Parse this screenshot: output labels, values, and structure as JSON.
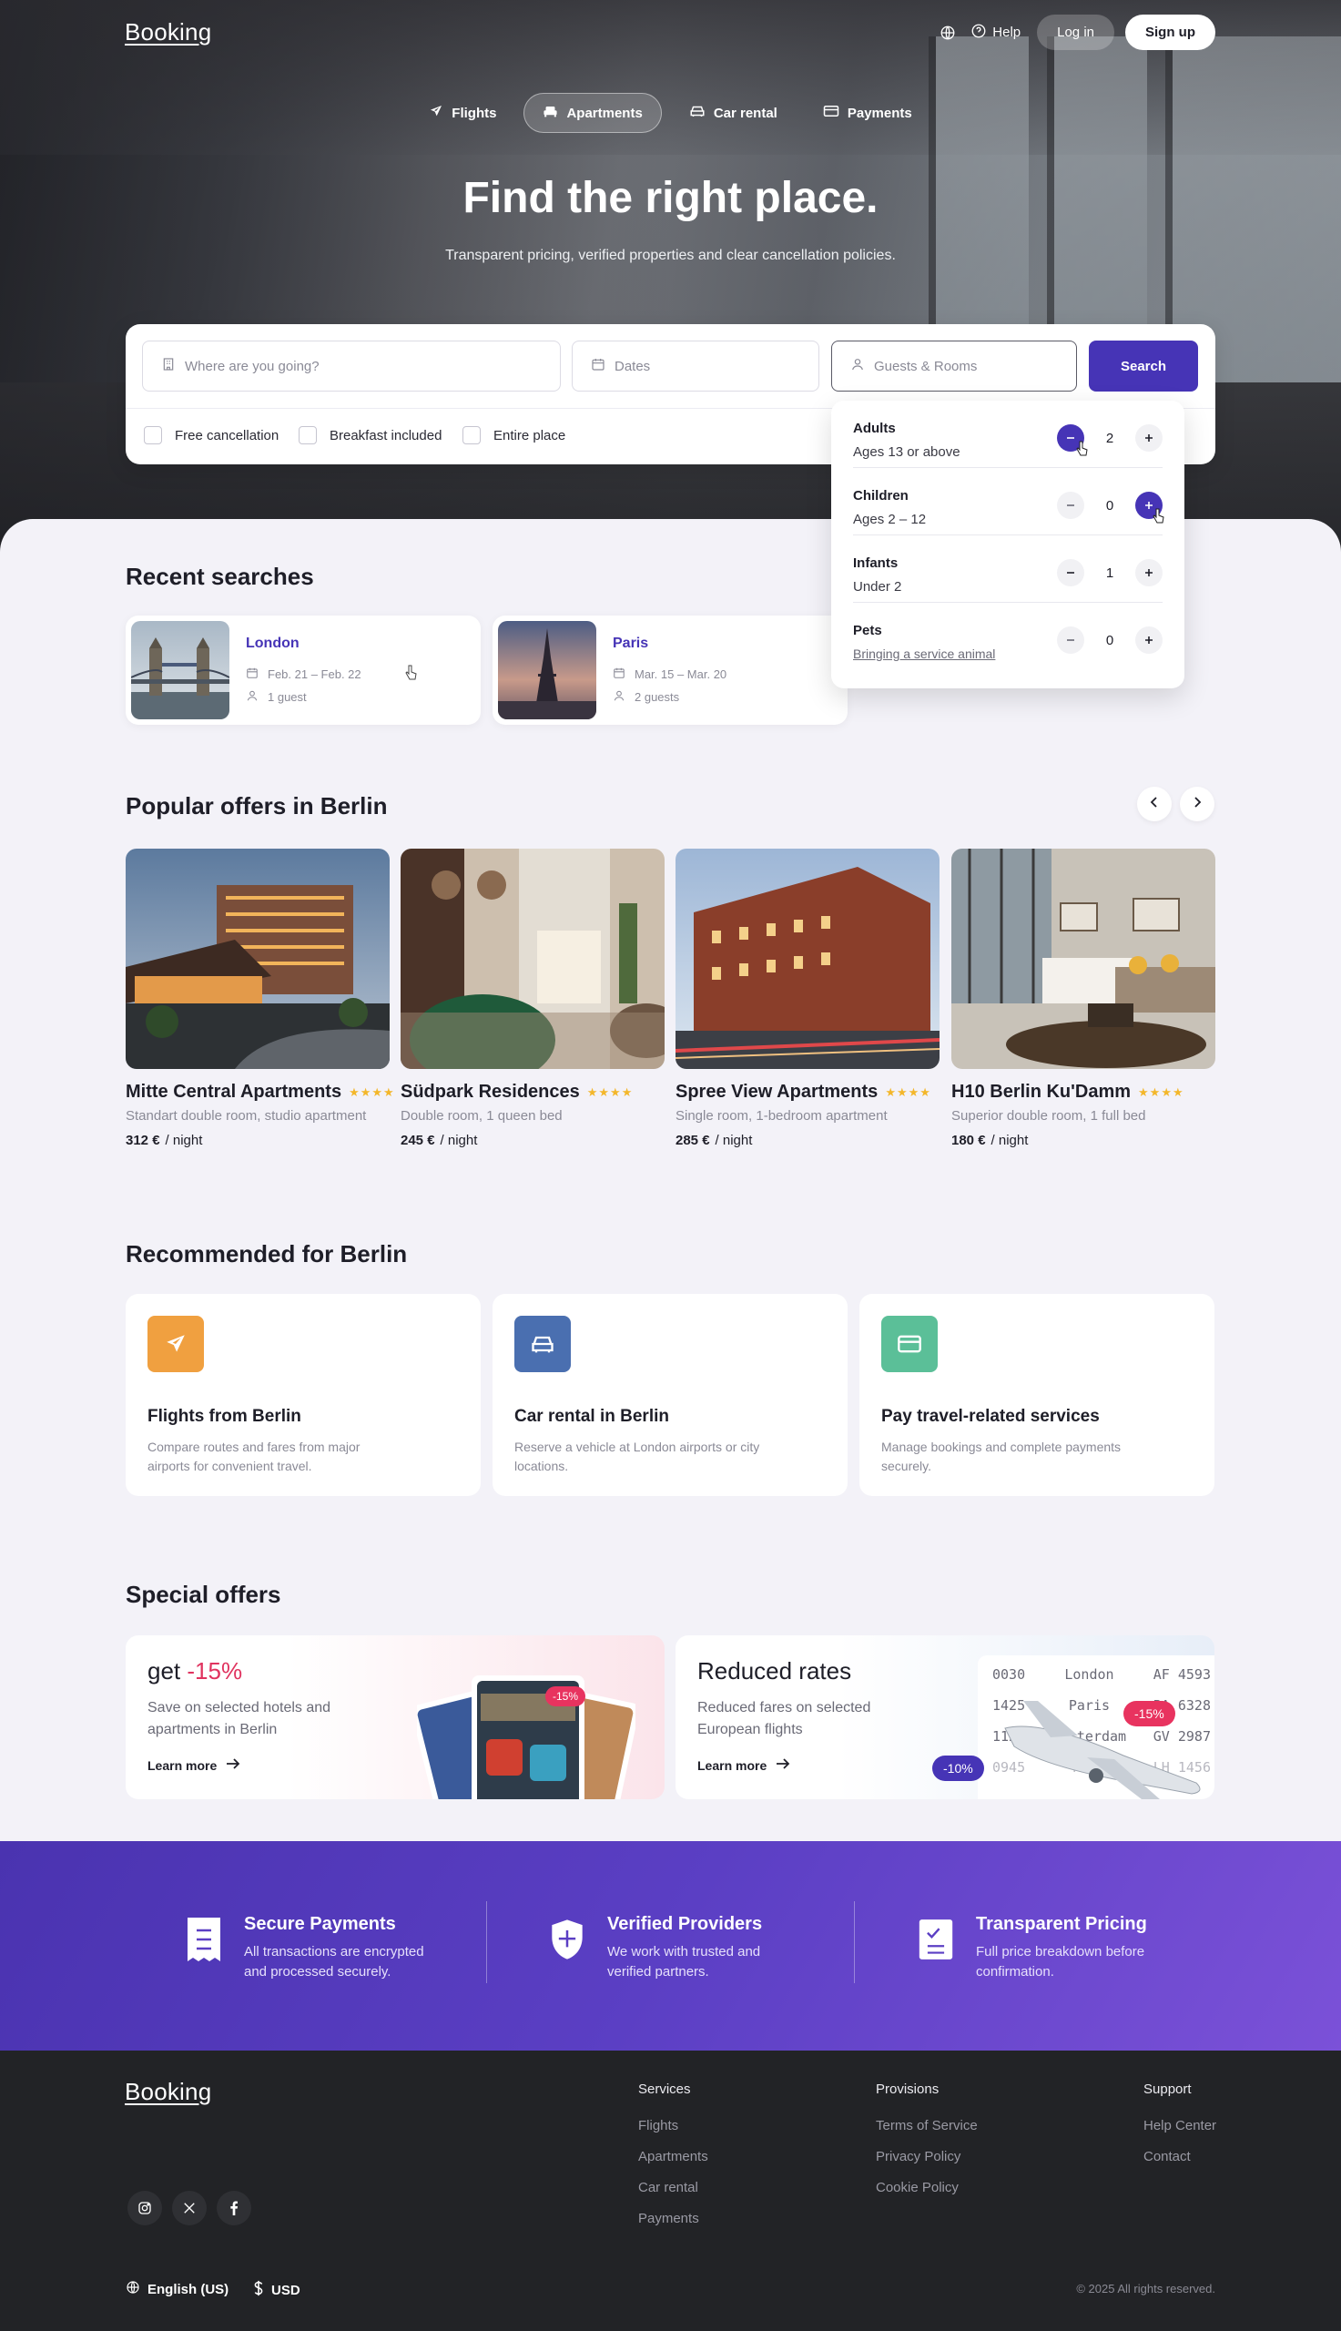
{
  "header": {
    "logo": "Booking",
    "help_label": "Help",
    "login_label": "Log in",
    "signup_label": "Sign up",
    "icons": [
      "globe-icon",
      "help-circle-icon"
    ]
  },
  "nav_tabs": [
    {
      "label": "Flights",
      "icon": "plane-icon",
      "active": false
    },
    {
      "label": "Apartments",
      "icon": "bed-icon",
      "active": true
    },
    {
      "label": "Car rental",
      "icon": "car-icon",
      "active": false
    },
    {
      "label": "Payments",
      "icon": "card-icon",
      "active": false
    }
  ],
  "hero": {
    "title": "Find the right place.",
    "subtitle": "Transparent pricing, verified properties and clear cancellation policies."
  },
  "search": {
    "destination_placeholder": "Where are you going?",
    "dates_placeholder": "Dates",
    "guests_placeholder": "Guests & Rooms",
    "button_label": "Search",
    "filters": [
      {
        "label": "Free cancellation",
        "checked": false
      },
      {
        "label": "Breakfast included",
        "checked": false
      },
      {
        "label": "Entire place",
        "checked": false
      }
    ]
  },
  "guests_dropdown": {
    "rows": [
      {
        "label": "Adults",
        "sub": "Ages 13 or above",
        "value": "2"
      },
      {
        "label": "Children",
        "sub": "Ages 2 – 12",
        "value": "0"
      },
      {
        "label": "Infants",
        "sub": "Under 2",
        "value": "1"
      },
      {
        "label": "Pets",
        "sub": "Bringing a service animal",
        "value": "0"
      }
    ]
  },
  "recent": {
    "title": "Recent searches",
    "items": [
      {
        "city": "London",
        "dates": "Feb. 21 – Feb. 22",
        "guests": "1 guest"
      },
      {
        "city": "Paris",
        "dates": "Mar. 15 – Mar. 20",
        "guests": "2 guests"
      }
    ]
  },
  "popular": {
    "title": "Popular offers in Berlin",
    "items": [
      {
        "name": "Mitte Central Apartments",
        "stars": "★★★★",
        "desc": "Standart double room, studio apartment",
        "price": "312 €",
        "unit": "/ night"
      },
      {
        "name": "Südpark Residences",
        "stars": "★★★★",
        "desc": "Double room, 1 queen bed",
        "price": "245 €",
        "unit": "/ night"
      },
      {
        "name": "Spree View Apartments",
        "stars": "★★★★",
        "desc": "Single room, 1-bedroom apartment",
        "price": "285 €",
        "unit": "/ night"
      },
      {
        "name": "H10 Berlin Ku'Damm",
        "stars": "★★★★",
        "desc": "Superior double room, 1 full bed",
        "price": "180 €",
        "unit": "/ night"
      }
    ]
  },
  "recommended": {
    "title": "Recommended for Berlin",
    "items": [
      {
        "title": "Flights from Berlin",
        "desc": "Compare routes and fares from major airports for convenient travel.",
        "color": "#f0a040"
      },
      {
        "title": "Car rental in Berlin",
        "desc": "Reserve a vehicle at London airports or city locations.",
        "color": "#4a6fb0"
      },
      {
        "title": "Pay travel-related services",
        "desc": "Manage bookings and complete payments securely.",
        "color": "#5bbf98"
      }
    ]
  },
  "special": {
    "title": "Special offers",
    "left": {
      "prefix": "get ",
      "highlight": "-15%",
      "desc": "Save on selected hotels and apartments in Berlin",
      "link": "Learn more",
      "badge": "-15%"
    },
    "right": {
      "title": "Reduced rates",
      "desc": "Reduced fares on selected European flights",
      "link": "Learn more",
      "badge_left": "-10%",
      "badge_right": "-15%",
      "board": [
        {
          "time": "0030",
          "city": "London",
          "code": "AF 4593"
        },
        {
          "time": "1425",
          "city": "Paris",
          "code": "BA 6328"
        },
        {
          "time": "1120",
          "city": "Amsterdam",
          "code": "GV 2987"
        },
        {
          "time": "0945",
          "city": "Rome",
          "code": "LH 1456"
        }
      ]
    }
  },
  "trust": [
    {
      "title": "Secure Payments",
      "desc": "All transactions are encrypted and processed securely."
    },
    {
      "title": "Verified Providers",
      "desc": "We work with trusted and verified partners."
    },
    {
      "title": "Transparent Pricing",
      "desc": "Full price breakdown before confirmation."
    }
  ],
  "footer": {
    "logo": "Booking",
    "columns": [
      {
        "heading": "Services",
        "links": [
          "Flights",
          "Apartments",
          "Car rental",
          "Payments"
        ]
      },
      {
        "heading": "Provisions",
        "links": [
          "Terms of Service",
          "Privacy Policy",
          "Cookie Policy"
        ]
      },
      {
        "heading": "Support",
        "links": [
          "Help Center",
          "Contact"
        ]
      }
    ],
    "language": "English (US)",
    "currency": "USD",
    "copyright": "© 2025 All rights reserved."
  },
  "colors": {
    "primary": "#4634b6",
    "accent_red": "#e0335f",
    "star": "#f3b72b"
  }
}
